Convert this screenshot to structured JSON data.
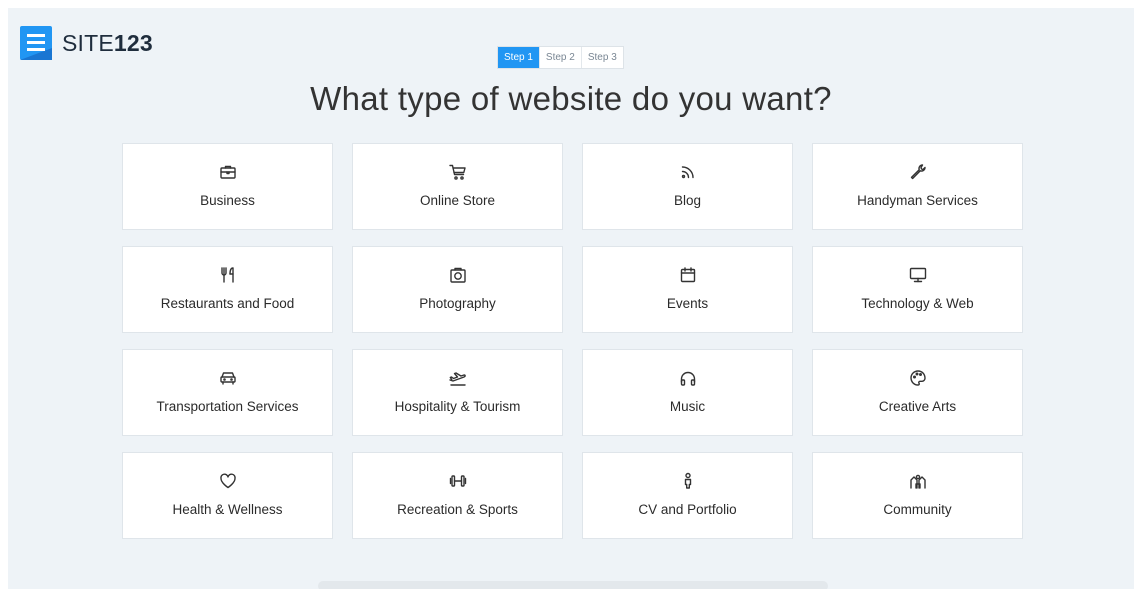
{
  "brand": {
    "name_light": "SITE",
    "name_bold": "123",
    "accent_color": "#2196f3"
  },
  "steps": [
    {
      "label": "Step 1",
      "active": true
    },
    {
      "label": "Step 2",
      "active": false
    },
    {
      "label": "Step 3",
      "active": false
    }
  ],
  "headline": "What type of website do you want?",
  "categories": [
    {
      "label": "Business",
      "icon": "briefcase-icon"
    },
    {
      "label": "Online Store",
      "icon": "shopping-cart-icon"
    },
    {
      "label": "Blog",
      "icon": "rss-icon"
    },
    {
      "label": "Handyman Services",
      "icon": "wrench-icon"
    },
    {
      "label": "Restaurants and Food",
      "icon": "utensils-icon"
    },
    {
      "label": "Photography",
      "icon": "camera-icon"
    },
    {
      "label": "Events",
      "icon": "calendar-icon"
    },
    {
      "label": "Technology & Web",
      "icon": "monitor-icon"
    },
    {
      "label": "Transportation Services",
      "icon": "car-icon"
    },
    {
      "label": "Hospitality & Tourism",
      "icon": "plane-icon"
    },
    {
      "label": "Music",
      "icon": "headphones-icon"
    },
    {
      "label": "Creative Arts",
      "icon": "palette-icon"
    },
    {
      "label": "Health & Wellness",
      "icon": "heart-icon"
    },
    {
      "label": "Recreation & Sports",
      "icon": "dumbbell-icon"
    },
    {
      "label": "CV and Portfolio",
      "icon": "person-icon"
    },
    {
      "label": "Community",
      "icon": "community-icon"
    }
  ]
}
